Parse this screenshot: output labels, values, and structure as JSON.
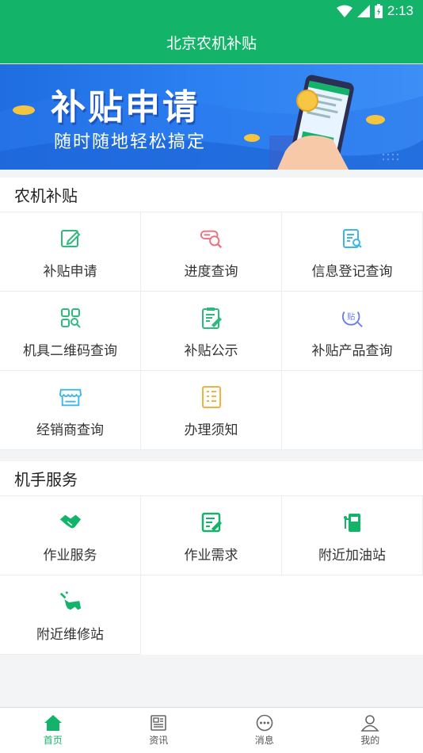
{
  "status": {
    "time": "2:13"
  },
  "app": {
    "title": "北京农机补贴"
  },
  "banner": {
    "title": "补贴申请",
    "subtitle": "随时随地轻松搞定"
  },
  "sections": [
    {
      "title": "农机补贴",
      "items": [
        {
          "label": "补贴申请",
          "icon": "edit-icon",
          "color": "#2dbb7d"
        },
        {
          "label": "进度查询",
          "icon": "progress-search-icon",
          "color": "#f06e7c"
        },
        {
          "label": "信息登记查询",
          "icon": "document-search-icon",
          "color": "#3cb7e8"
        },
        {
          "label": "机具二维码查询",
          "icon": "qrcode-search-icon",
          "color": "#2dbb7d"
        },
        {
          "label": "补贴公示",
          "icon": "clipboard-edit-icon",
          "color": "#2dbb7d"
        },
        {
          "label": "补贴产品查询",
          "icon": "product-search-icon",
          "color": "#6b7cf0"
        },
        {
          "label": "经销商查询",
          "icon": "store-icon",
          "color": "#3cb7e8"
        },
        {
          "label": "办理须知",
          "icon": "notice-icon",
          "color": "#f3b23f"
        }
      ]
    },
    {
      "title": "机手服务",
      "items": [
        {
          "label": "作业服务",
          "icon": "handshake-icon",
          "color": "#13b36a"
        },
        {
          "label": "作业需求",
          "icon": "requirement-icon",
          "color": "#13b36a"
        },
        {
          "label": "附近加油站",
          "icon": "gas-station-icon",
          "color": "#13b36a"
        },
        {
          "label": "附近维修站",
          "icon": "repair-icon",
          "color": "#13b36a"
        }
      ]
    }
  ],
  "tabs": [
    {
      "label": "首页",
      "icon": "home-icon",
      "active": true
    },
    {
      "label": "资讯",
      "icon": "news-icon",
      "active": false
    },
    {
      "label": "消息",
      "icon": "message-icon",
      "active": false
    },
    {
      "label": "我的",
      "icon": "user-icon",
      "active": false
    }
  ],
  "colors": {
    "primary": "#13b36a",
    "banner": "#2b7ff0"
  }
}
